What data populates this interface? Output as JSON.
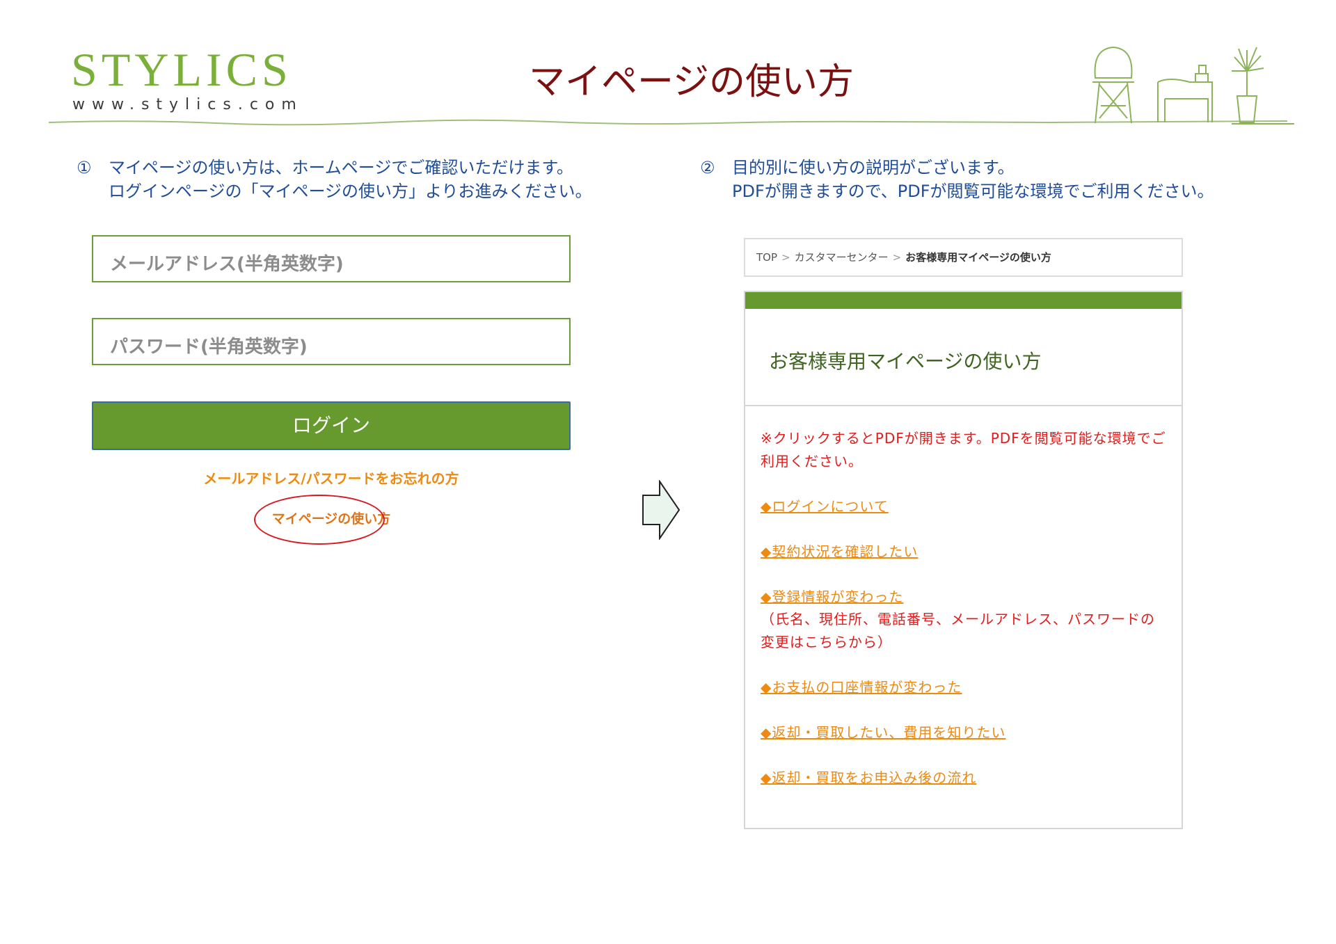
{
  "header": {
    "logo_text": "STYLICS",
    "logo_url": "www.stylics.com",
    "title": "マイページの使い方"
  },
  "instructions": {
    "step1": {
      "number": "①",
      "line1": "マイページの使い方は、ホームページでご確認いただけます。",
      "line2": "ログインページの「マイページの使い方」よりお進みください。"
    },
    "step2": {
      "number": "②",
      "line1": "目的別に使い方の説明がございます。",
      "line2": "PDFが開きますので、PDFが閲覧可能な環境でご利用ください。"
    }
  },
  "login": {
    "email_placeholder": "メールアドレス(半角英数字)",
    "password_placeholder": "パスワード(半角英数字)",
    "login_label": "ログイン",
    "forgot_label": "メールアドレス/パスワードをお忘れの方",
    "howto_label": "マイページの使い方"
  },
  "breadcrumb": {
    "items": [
      "TOP",
      "カスタマーセンター"
    ],
    "current": "お客様専用マイページの使い方",
    "separator": ">"
  },
  "panel": {
    "title": "お客様専用マイページの使い方",
    "notice": "※クリックするとPDFが開きます。PDFを閲覧可能な環境でご利用ください。",
    "links": [
      "◆ログインについて",
      "◆契約状況を確認したい",
      "◆登録情報が変わった",
      "◆お支払の口座情報が変わった",
      "◆返却・買取したい、費用を知りたい",
      "◆返却・買取をお申込み後の流れ"
    ],
    "link3_note": "（氏名、現住所、電話番号、メールアドレス、パスワードの変更はこちらから）"
  },
  "colors": {
    "brand_green": "#66992e",
    "logo_green": "#7ab03a",
    "title_red": "#7a1010",
    "instruction_blue": "#1f4d9a",
    "link_orange": "#ed8a12",
    "notice_red": "#e31b1b",
    "highlight_red": "#d71920"
  },
  "icons": {
    "arrow": "right-arrow-icon",
    "furniture": "furniture-illustration"
  }
}
